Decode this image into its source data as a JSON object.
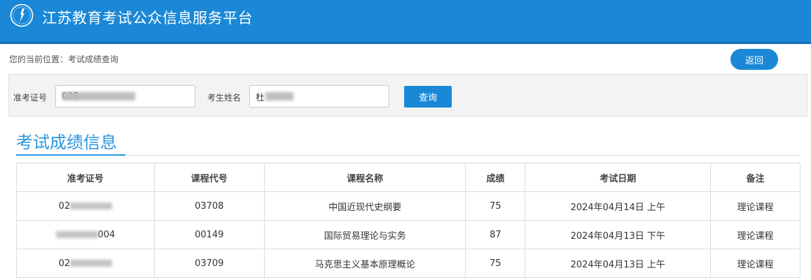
{
  "header": {
    "title": "江苏教育考试公众信息服务平台",
    "logo": "exam-logo-icon"
  },
  "breadcrumb": "您的当前位置：考试成绩查询",
  "back_button": "返回",
  "search": {
    "id_label": "准考证号",
    "id_value": "025",
    "name_label": "考生姓名",
    "name_value": "杜",
    "query_button": "查询"
  },
  "section_title": "考试成绩信息",
  "table": {
    "headers": [
      "准考证号",
      "课程代号",
      "课程名称",
      "成绩",
      "考试日期",
      "备注"
    ],
    "rows": [
      {
        "id_visible": "02",
        "code": "03708",
        "name": "中国近现代史纲要",
        "score": "75",
        "date": "2024年04月14日 上午",
        "note": "理论课程"
      },
      {
        "id_visible": "004",
        "code": "00149",
        "name": "国际贸易理论与实务",
        "score": "87",
        "date": "2024年04月13日 下午",
        "note": "理论课程"
      },
      {
        "id_visible": "02",
        "code": "03709",
        "name": "马克思主义基本原理概论",
        "score": "75",
        "date": "2024年04月13日 上午",
        "note": "理论课程"
      }
    ]
  },
  "colors": {
    "brand": "#1a88d6",
    "title": "#2a96df"
  }
}
